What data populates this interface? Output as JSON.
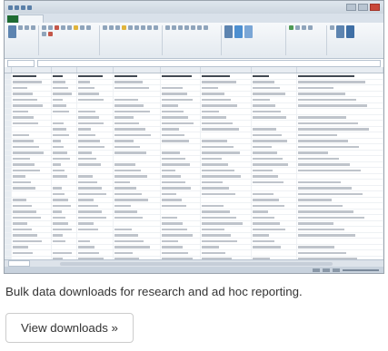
{
  "caption": "Bulk data downloads for research and ad hoc reporting.",
  "view_button_label": "View downloads »",
  "screenshot": {
    "description_icon": "spreadsheet-screenshot",
    "accent": "#1f6b33"
  }
}
